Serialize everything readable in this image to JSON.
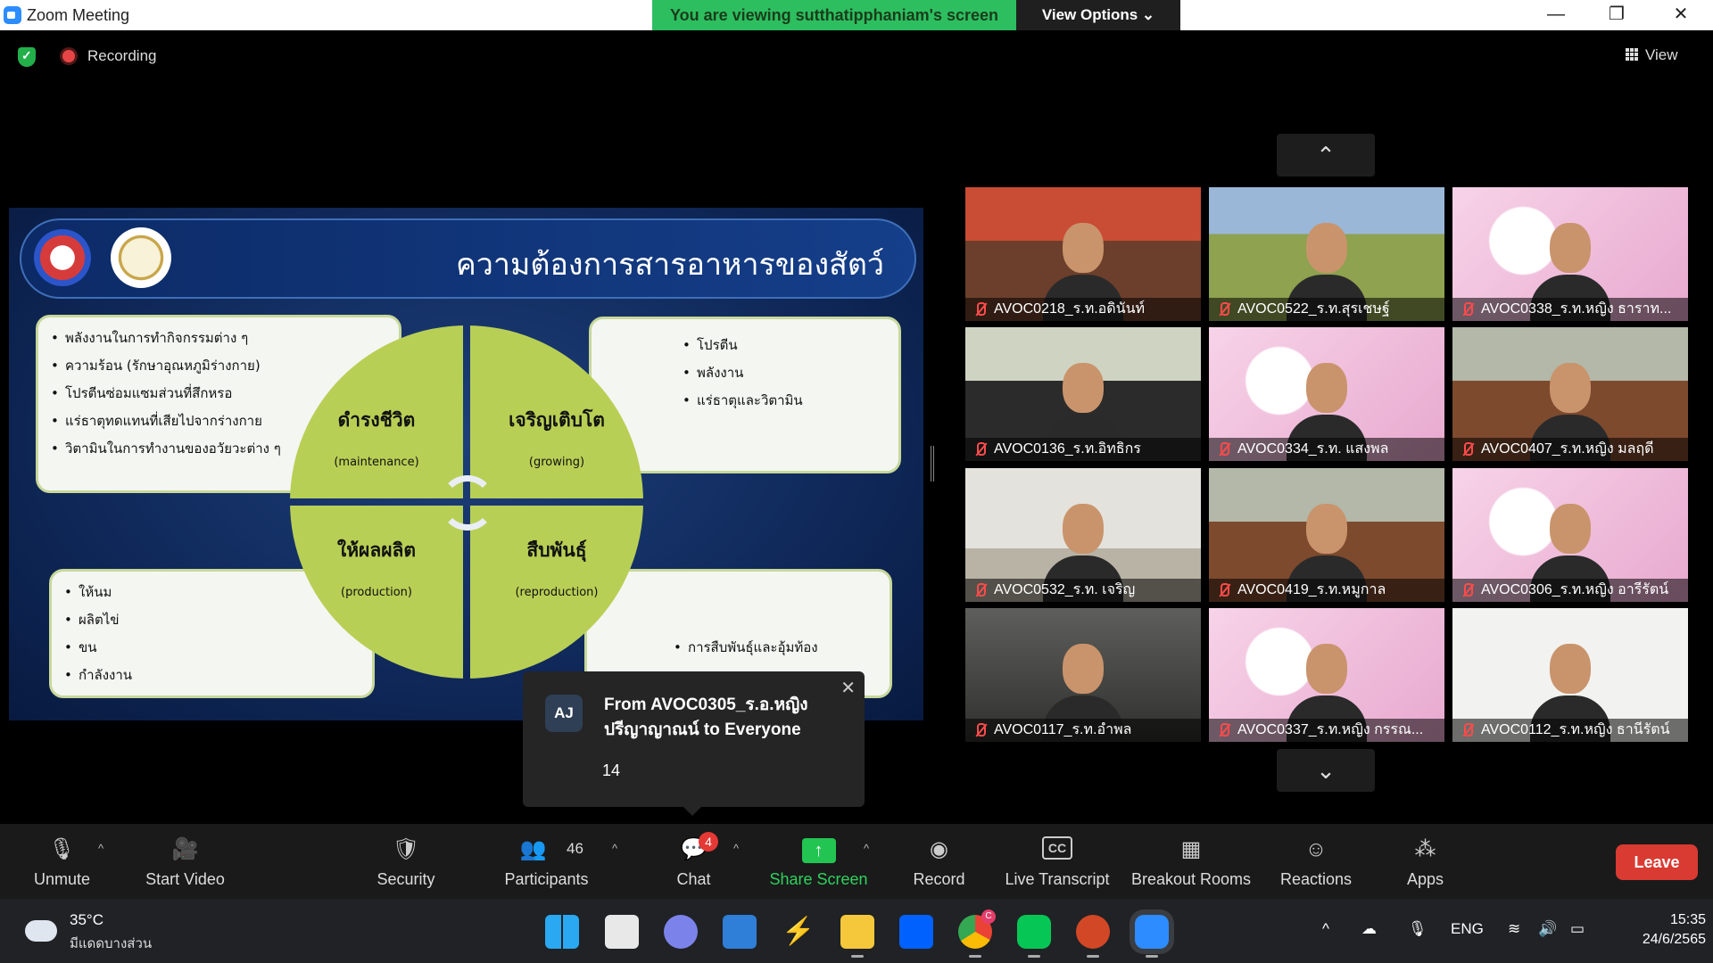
{
  "window": {
    "title": "Zoom Meeting",
    "banner": "You are viewing sutthatipphaniam's screen",
    "view_options": "View Options ⌄",
    "min": "—",
    "restore": "❐",
    "close": "✕"
  },
  "status": {
    "recording": "Recording",
    "view": "View"
  },
  "slide": {
    "title": "ความต้องการสารอาหารของสัตว์",
    "top_left": [
      "พลังงานในการทำกิจกรรมต่าง ๆ",
      "ความร้อน (รักษาอุณหภูมิร่างกาย)",
      "โปรตีนซ่อมแซมส่วนที่สึกหรอ",
      "แร่ธาตุทดแทนที่เสียไปจากร่างกาย",
      "วิตามินในการทำงานของอวัยวะต่าง ๆ"
    ],
    "top_right": [
      "โปรตีน",
      "พลังงาน",
      "แร่ธาตุและวิตามิน"
    ],
    "bottom_left": [
      "ให้นม",
      "ผลิตไข่",
      "ขน",
      "กำลังงาน"
    ],
    "bottom_right": "การสืบพันธุ์และอุ้มท้อง",
    "quadrants": [
      {
        "th": "ดำรงชีวิต",
        "en": "(maintenance)"
      },
      {
        "th": "เจริญเติบโต",
        "en": "(growing)"
      },
      {
        "th": "ให้ผลผลิต",
        "en": "(production)"
      },
      {
        "th": "สืบพันธุ์",
        "en": "(reproduction)"
      }
    ]
  },
  "chat_popup": {
    "avatar": "AJ",
    "from": "From AVOC0305_ร.อ.หญิง ปรีญาญาณน์ to Everyone",
    "message": "14",
    "close": "✕"
  },
  "gallery": {
    "up": "⌃",
    "down": "⌄",
    "participants": [
      "AVOC0218_ร.ท.อดินันท์",
      "AVOC0522_ร.ท.สุรเชษฐ์",
      "AVOC0338_ร.ท.หญิง ธาราท...",
      "AVOC0136_ร.ท.อิทธิกร",
      "AVOC0334_ร.ท. แสงพล",
      "AVOC0407_ร.ท.หญิง มลฤดี",
      "AVOC0532_ร.ท. เจริญ",
      "AVOC0419_ร.ท.หมูกาล",
      "AVOC0306_ร.ท.หญิง อารีรัตน์",
      "AVOC0117_ร.ท.อำพล",
      "AVOC0337_ร.ท.หญิง กรรณ...",
      "AVOC0112_ร.ท.หญิง ธานีรัตน์"
    ]
  },
  "toolbar": {
    "unmute": "Unmute",
    "start_video": "Start Video",
    "security": "Security",
    "participants": "Participants",
    "participants_count": "46",
    "chat": "Chat",
    "chat_badge": "4",
    "share_screen": "Share Screen",
    "record": "Record",
    "live_transcript": "Live Transcript",
    "breakout_rooms": "Breakout Rooms",
    "reactions": "Reactions",
    "apps": "Apps",
    "leave": "Leave",
    "caret": "^"
  },
  "taskbar": {
    "temperature": "35°C",
    "condition": "มีแดดบางส่วน",
    "language": "ENG",
    "time": "15:35",
    "date": "24/6/2565",
    "chrome_badge": "C"
  },
  "colors": {
    "banner_green": "#2dbe60",
    "wheel_green": "#b8cf55",
    "leave_red": "#d93a32",
    "share_green": "#23c552"
  }
}
